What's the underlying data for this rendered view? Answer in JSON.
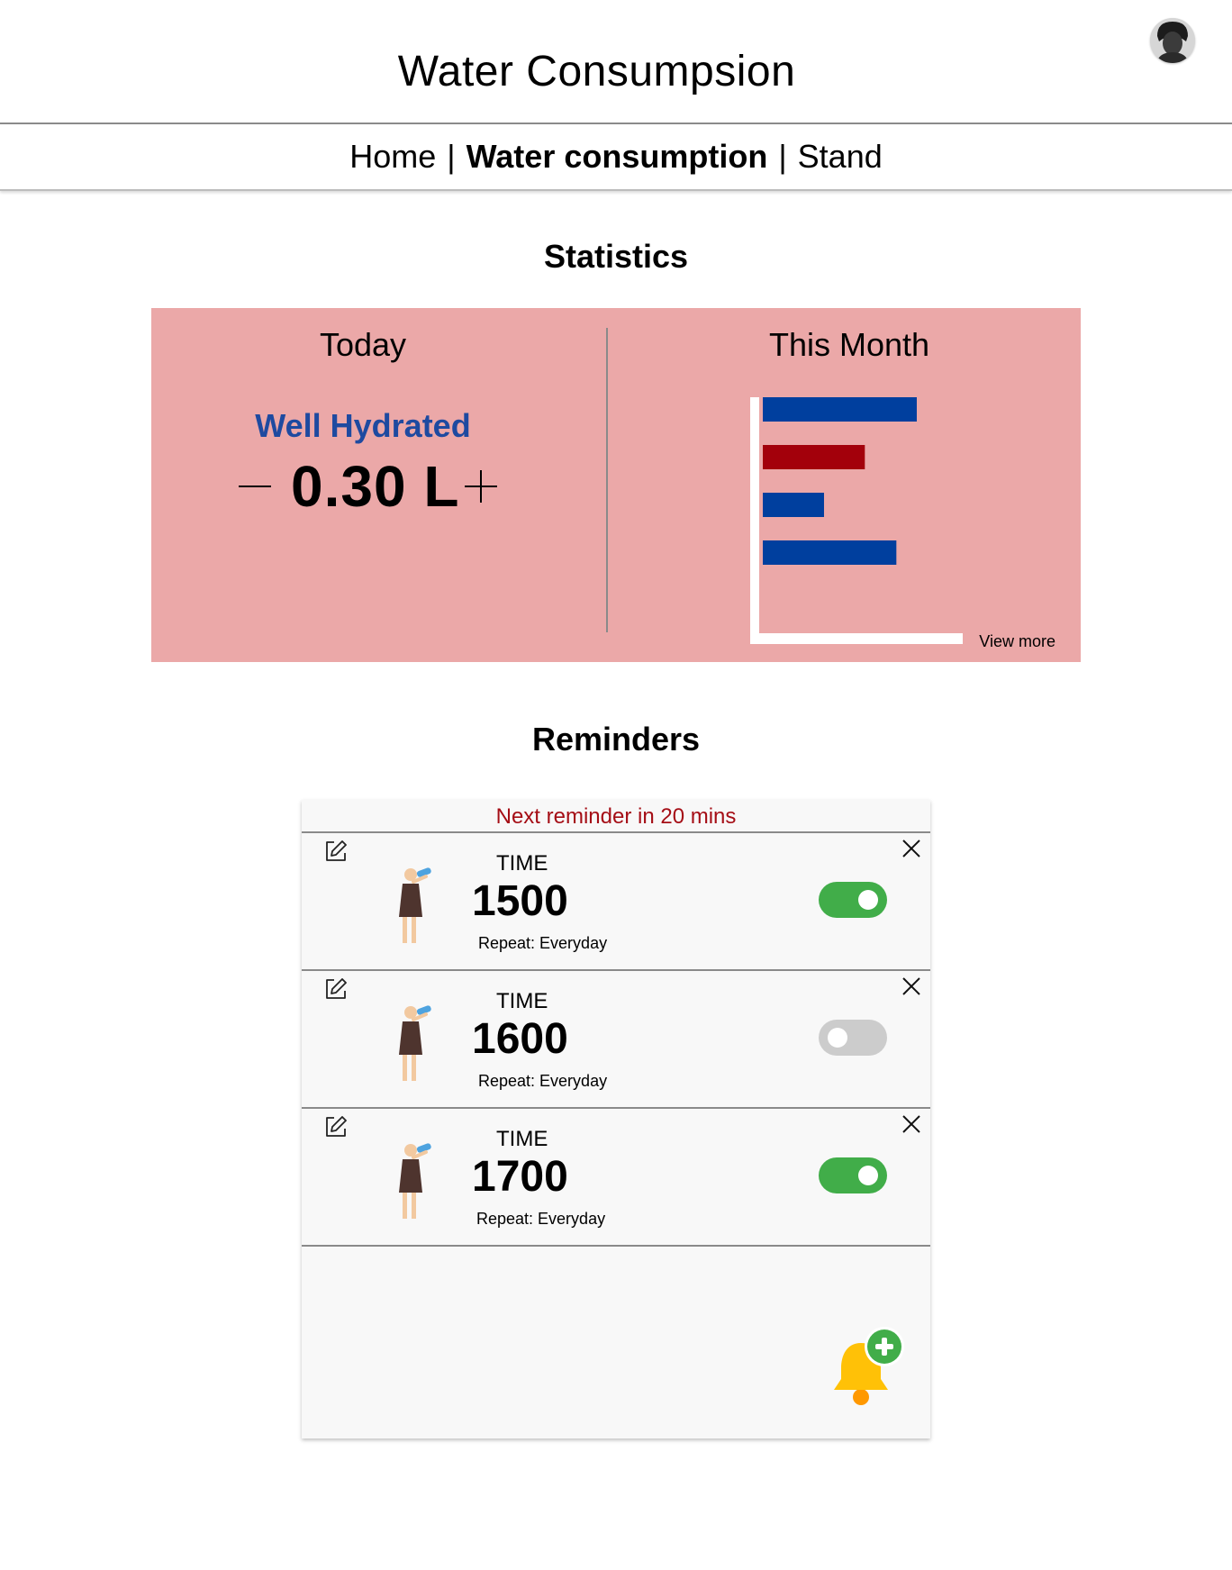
{
  "header": {
    "title": "Water Consumpsion"
  },
  "nav": {
    "items": [
      {
        "label": "Home",
        "active": false
      },
      {
        "label": "Water consumption",
        "active": true
      },
      {
        "label": "Stand",
        "active": false
      }
    ],
    "separator": "|"
  },
  "statistics": {
    "heading": "Statistics",
    "today": {
      "label": "Today",
      "status": "Well Hydrated",
      "amount": "0.30 L"
    },
    "month": {
      "label": "This Month",
      "view_more": "View more"
    }
  },
  "chart_data": {
    "type": "bar",
    "orientation": "horizontal",
    "title": "This Month",
    "xlabel": "",
    "ylabel": "",
    "xlim": [
      0,
      1
    ],
    "categories": [
      "",
      "",
      "",
      ""
    ],
    "values": [
      0.83,
      0.55,
      0.33,
      0.72
    ],
    "colors": [
      "#003f9e",
      "#a3000b",
      "#003f9e",
      "#003f9e"
    ],
    "grid": false,
    "legend": false
  },
  "reminders": {
    "heading": "Reminders",
    "next_reminder": "Next reminder in 20 mins",
    "time_label": "TIME",
    "items": [
      {
        "time": "1500",
        "repeat": "Repeat: Everyday",
        "enabled": true
      },
      {
        "time": "1600",
        "repeat": "Repeat: Everyday",
        "enabled": false
      },
      {
        "time": "1700",
        "repeat": "Repeat: Everyday",
        "enabled": true
      }
    ]
  },
  "colors": {
    "stats_background": "#eba8a8",
    "status_blue": "#1e4aa0",
    "reminder_red": "#a50e16",
    "toggle_on": "#41ad49",
    "toggle_off": "#cccccc",
    "bell_yellow": "#ffc107"
  },
  "icons": {
    "avatar": "user-avatar",
    "edit": "edit-icon",
    "close": "close-icon",
    "drink": "person-drinking-water-icon",
    "add_reminder": "bell-plus-icon"
  }
}
